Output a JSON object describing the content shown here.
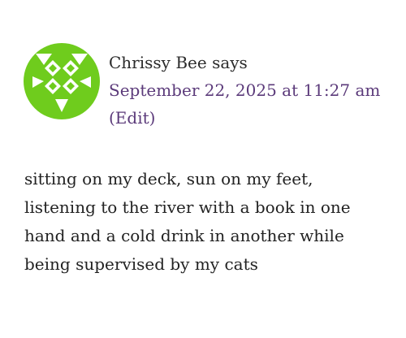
{
  "comment": {
    "author": "Chrissy Bee",
    "says": "says",
    "date": "September 22, 2025 at 11:27 am",
    "edit_label": "(Edit)",
    "body_lines": [
      "sitting on my deck, sun on my feet,",
      "listening to the river with a book in one",
      "hand and a cold drink in another while",
      "being supervised by my cats"
    ],
    "avatar": {
      "icon": "identicon-avatar-icon",
      "color": "#6fcc1d"
    },
    "link_color": "#5b3a7a"
  }
}
